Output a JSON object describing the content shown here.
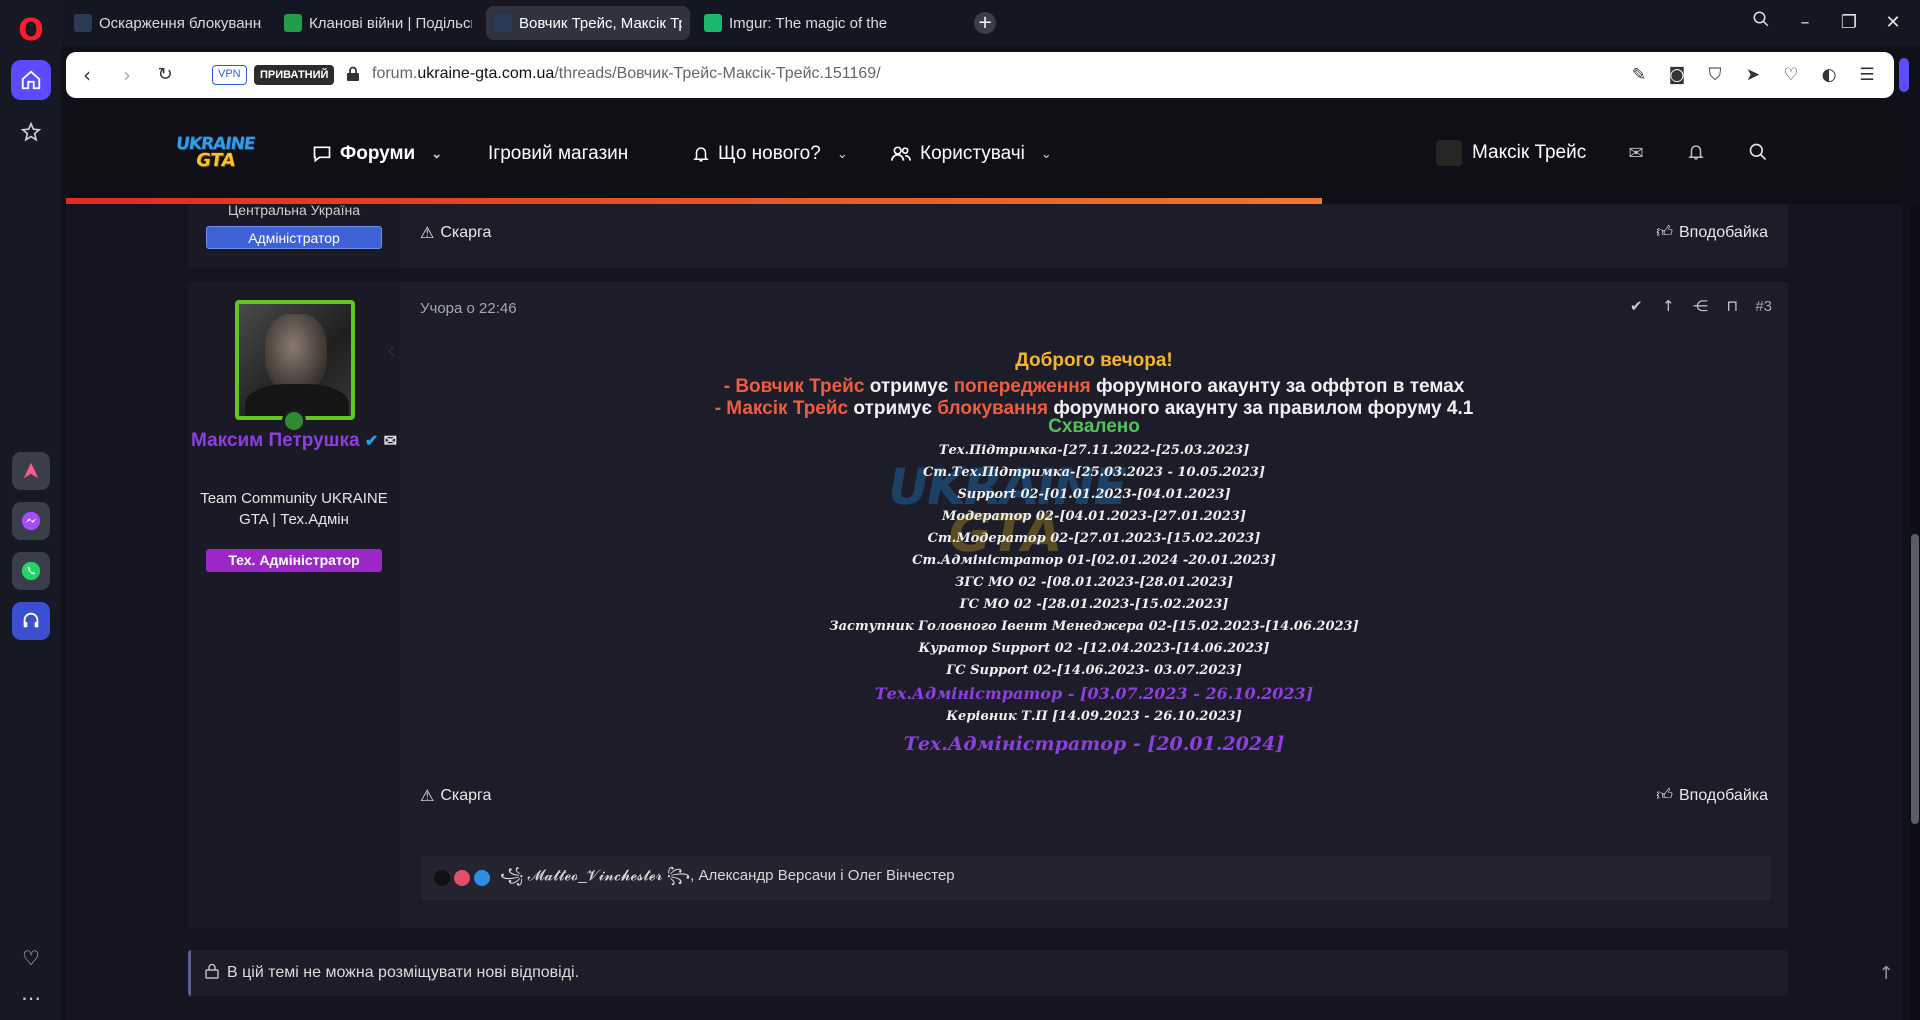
{
  "browser": {
    "tabs": [
      {
        "title": "Оскарження блокування",
        "favicon_color": "#2b3a55"
      },
      {
        "title": "Кланові війни | Подільська",
        "favicon_color": "#1f9d48"
      },
      {
        "title": "Вовчик Трейс, Максік Трейс",
        "favicon_color": "#2b3a55"
      },
      {
        "title": "Imgur: The magic of the Internet",
        "favicon_color": "#1bb76e"
      }
    ],
    "new_tab_label": "+",
    "vpn_label": "VPN",
    "private_label": "ПРИВАТНИЙ",
    "url_prefix": "forum.",
    "url_host": "ukraine-gta.com.ua",
    "url_path": "/threads/Вовчик-Трейс-Максік-Трейс.151169/"
  },
  "forum_nav": {
    "logo_line1": "UKRAINE",
    "logo_line2": "GTA",
    "forums": "Форуми",
    "shop": "Ігровий магазин",
    "whats_new": "Що нового?",
    "users": "Користувачі",
    "username": "Максік Трейс"
  },
  "post1": {
    "location": "Центральна Україна",
    "role": "Адміністратор",
    "report": "Скарга",
    "like": "Вподобайка"
  },
  "post2": {
    "author_name": "Максим Петрушка",
    "author_title": "Team Community UKRAINE GTA | Тех.Адмін",
    "role": "Тех. Адміністратор",
    "date": "Учора о 22:46",
    "number": "#3",
    "greeting": "Доброго вечора!",
    "line1": {
      "dash": "- ",
      "name": "Вовчик Трейс",
      "mid": " отримує ",
      "action": "попередження",
      "rest": " форумного акаунту за оффтоп в темах"
    },
    "line2": {
      "dash": "- ",
      "name": "Максік Трейс",
      "mid": " отримує ",
      "action": "блокування",
      "rest": " форумного акаунту за правилом форуму 4.1"
    },
    "approved": "Схвалено",
    "watermark_line1": "UKRAINE",
    "watermark_line2": "GTA",
    "history": [
      "Тех.Підтримка-[27.11.2022-[25.03.2023]",
      "Ст.Тех.Підтримка-[25.03.2023 - 10.05.2023]",
      "Support 02-[01.01.2023-[04.01.2023]",
      "Модератор 02-[04.01.2023-[27.01.2023]",
      "Ст.Модератор 02-[27.01.2023-[15.02.2023]",
      "Ст.Адміністратор 01-[02.01.2024 -20.01.2023]",
      "ЗГС МО 02 -[08.01.2023-[28.01.2023]",
      "ГС МО 02 -[28.01.2023-[15.02.2023]",
      "Заступник Головного Івент Менеджера 02-[15.02.2023-[14.06.2023]",
      "Куратор Support 02 -[12.04.2023-[14.06.2023]",
      "ГС Support 02-[14.06.2023- 03.07.2023]"
    ],
    "history_purple": "Тех.Адміністратор - [03.07.2023 - 26.10.2023]",
    "history_after": "Керівник Т.П [14.09.2023 - 26.10.2023]",
    "history_final": "Тех.Адміністратор - [20.01.2024]",
    "report": "Скарга",
    "like": "Вподобайка",
    "reactions_text": "꧁ 𝓜𝓪𝓽𝓽𝓮𝓸_𝓥𝓲𝓷𝓬𝓱𝓮𝓼𝓽𝓮𝓻 ꧂, Александр Версачи і Олег Вінчестер"
  },
  "notice": "В цій темі не можна розміщувати нові відповіді.",
  "colors": {
    "accent_purple": "#8f3ee0",
    "opera_red": "#ff1b2d",
    "avatar_border": "#66c51e",
    "greeting": "#f3b42f",
    "highlight_red": "#ef5d3f",
    "approved_green": "#53c25a"
  }
}
